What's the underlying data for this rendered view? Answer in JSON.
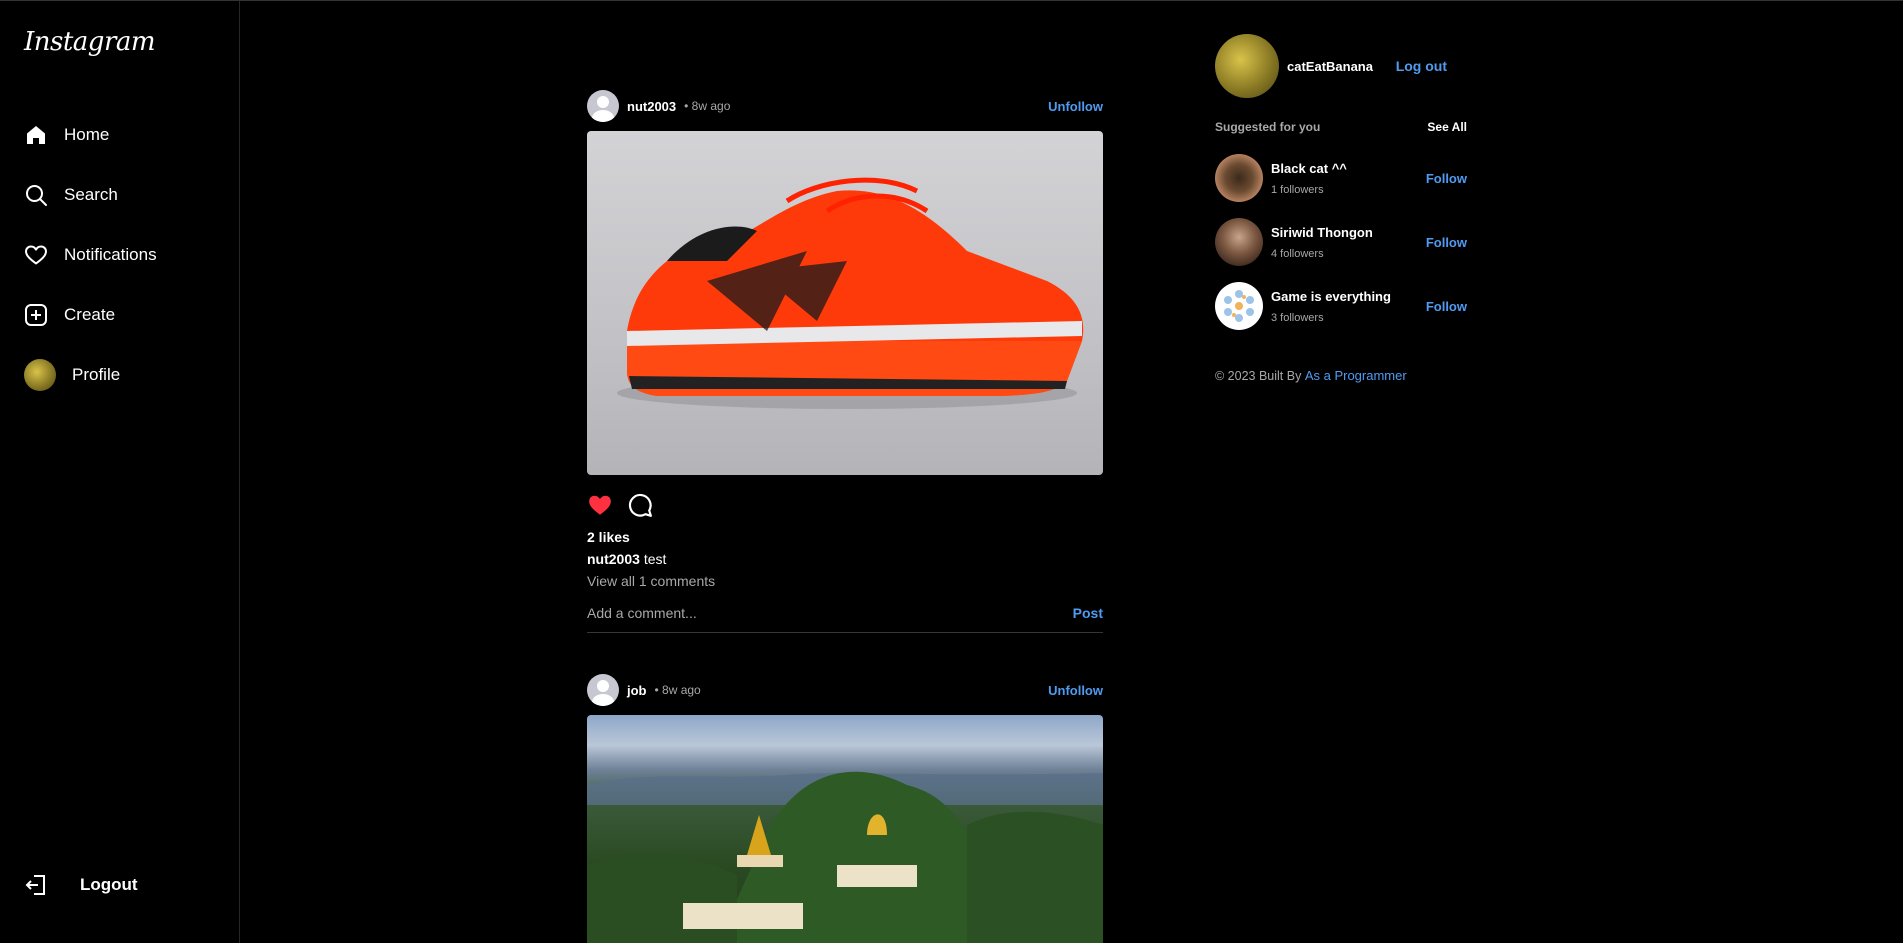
{
  "sidebar": {
    "logo": "Instagram",
    "items": [
      {
        "label": "Home",
        "icon": "home-icon"
      },
      {
        "label": "Search",
        "icon": "search-icon"
      },
      {
        "label": "Notifications",
        "icon": "heart-icon"
      },
      {
        "label": "Create",
        "icon": "plus-square-icon"
      },
      {
        "label": "Profile",
        "icon": "avatar"
      }
    ],
    "logout": "Logout"
  },
  "feed": {
    "posts": [
      {
        "user": "nut2003",
        "time": "• 8w ago",
        "action": "Unfollow",
        "likes": "2 likes",
        "caption_user": "nut2003",
        "caption_text": "test",
        "view_comments": "View all 1 comments",
        "comment_placeholder": "Add a comment...",
        "post_label": "Post"
      },
      {
        "user": "job",
        "time": "• 8w ago",
        "action": "Unfollow"
      }
    ]
  },
  "right": {
    "username": "catEatBanana",
    "logout": "Log out",
    "suggested_title": "Suggested for you",
    "see_all": "See All",
    "suggestions": [
      {
        "name": "Black cat ^^",
        "followers": "1 followers",
        "action": "Follow"
      },
      {
        "name": "Siriwid Thongon",
        "followers": "4 followers",
        "action": "Follow"
      },
      {
        "name": "Game is everything",
        "followers": "3 followers",
        "action": "Follow"
      }
    ],
    "footer_text": "© 2023 Built By",
    "footer_link": "As a Programmer"
  },
  "colors": {
    "background": "#000000",
    "link": "#4f9bf0",
    "muted": "#a8a8a8",
    "like": "#ff3040"
  }
}
